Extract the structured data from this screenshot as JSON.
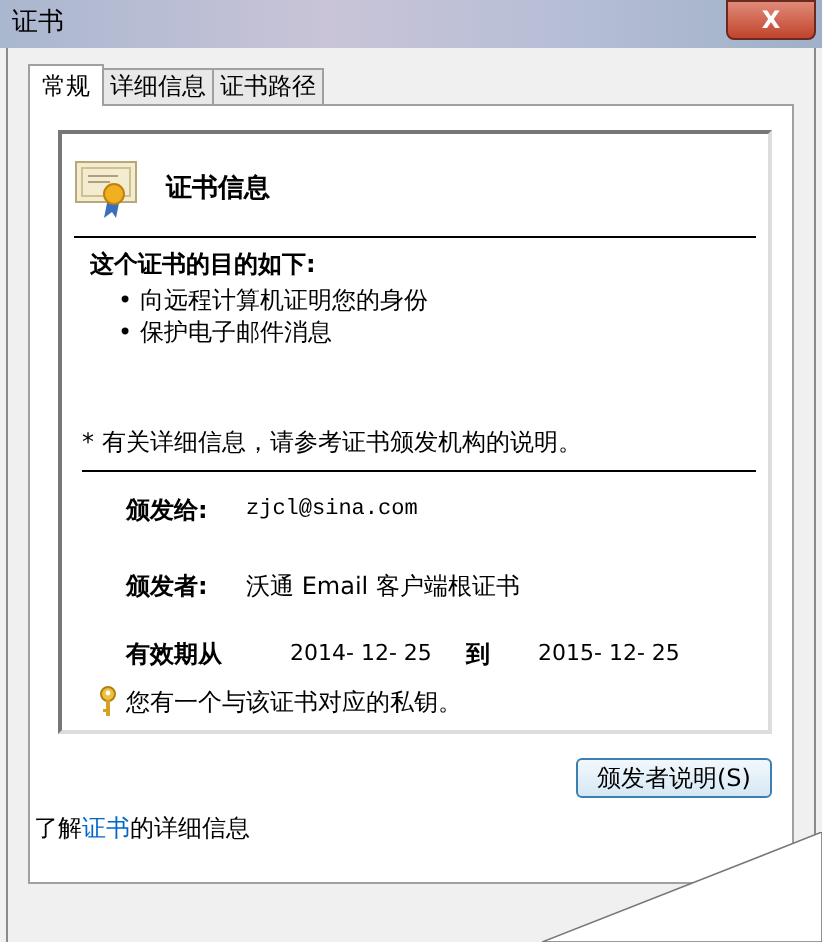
{
  "window": {
    "title": "证书",
    "close_button": "X"
  },
  "tabs": [
    {
      "label": "常规",
      "selected": true
    },
    {
      "label": "详细信息",
      "selected": false
    },
    {
      "label": "证书路径",
      "selected": false
    }
  ],
  "info": {
    "heading": "证书信息",
    "purpose_title": "这个证书的目的如下:",
    "purposes": [
      "• 向远程计算机证明您的身份",
      "• 保护电子邮件消息"
    ],
    "note": "* 有关详细信息，请参考证书颁发机构的说明。",
    "issued_to_label": "颁发给:",
    "issued_to": "zjcl@sina.com",
    "issued_by_label": "颁发者:",
    "issued_by": "沃通 Email 客户端根证书",
    "valid_from_label": "有效期从",
    "valid_from": "2014- 12- 25",
    "valid_to_label": "到",
    "valid_to": "2015- 12- 25",
    "private_key": "您有一个与该证书对应的私钥。"
  },
  "issuer_statement_button": "颁发者说明(S)",
  "learn_more": {
    "before": "了解",
    "link": "证书",
    "after": "的详细信息"
  }
}
